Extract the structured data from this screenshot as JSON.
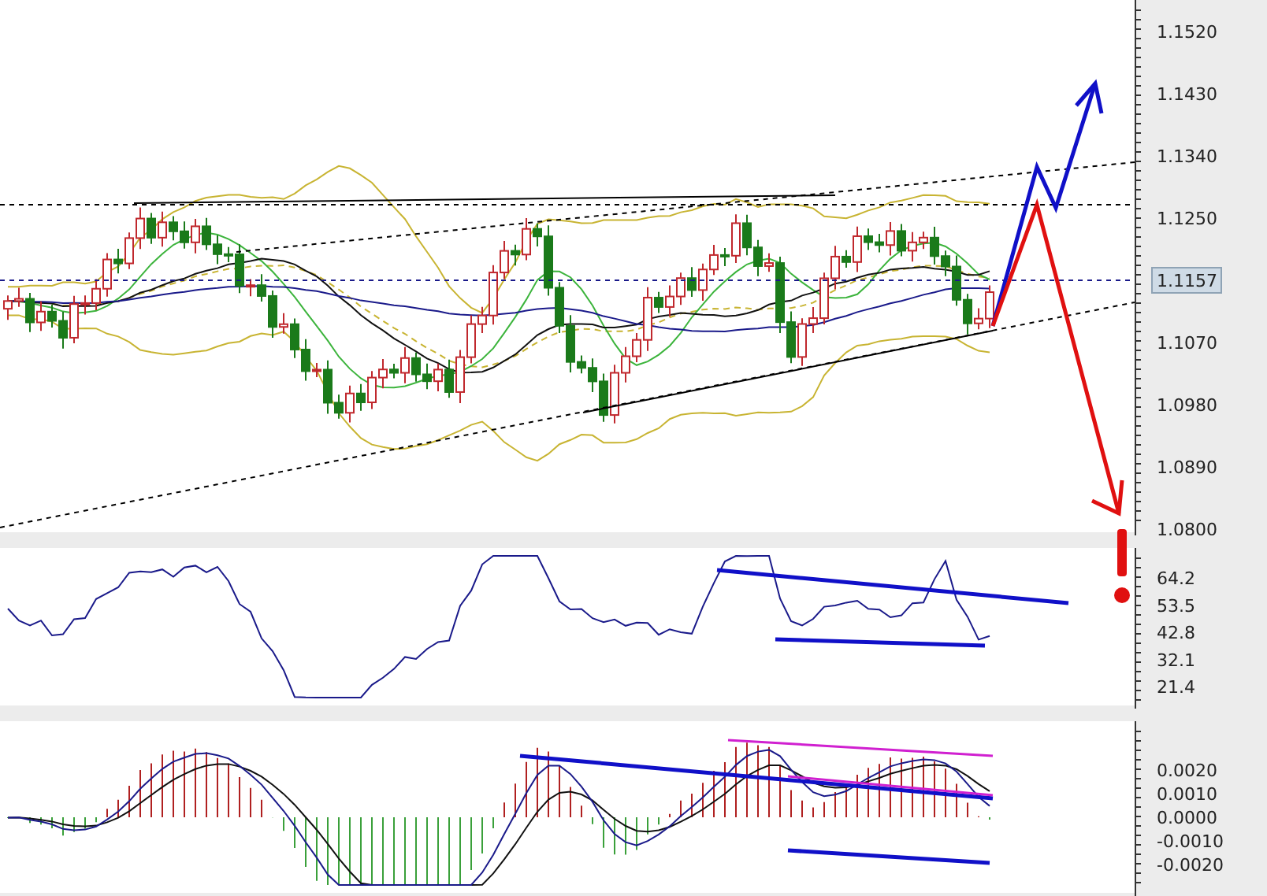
{
  "main_chart": {
    "price_labels": [
      "1.1520",
      "1.1430",
      "1.1340",
      "1.1250",
      "1.1070",
      "1.0980",
      "1.0890",
      "1.0800"
    ],
    "current_price": "1.1157"
  },
  "rsi_panel": {
    "labels": [
      "64.2",
      "53.5",
      "42.8",
      "32.1",
      "21.4"
    ]
  },
  "macd_panel": {
    "labels": [
      "0.0020",
      "0.0010",
      "0.0000",
      "-0.0010",
      "-0.0020"
    ]
  }
}
